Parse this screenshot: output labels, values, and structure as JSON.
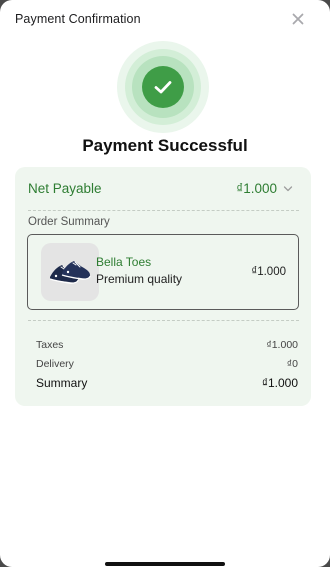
{
  "header": {
    "title": "Payment Confirmation"
  },
  "icons": {
    "close": "close-icon",
    "success": "check-icon",
    "expand": "chevron-down-icon"
  },
  "colors": {
    "accent": "#2e7d32",
    "success": "#3f9d47",
    "card_bg": "#eff6ef"
  },
  "status": {
    "title": "Payment Successful"
  },
  "net_payable": {
    "label": "Net Payable",
    "value": "₫1.000"
  },
  "order": {
    "label": "Order Summary",
    "items": [
      {
        "name": "Bella Toes",
        "description": "Premium quality",
        "price": "₫1.000"
      }
    ]
  },
  "summary": {
    "rows": [
      {
        "label": "Taxes",
        "value": "₫1.000"
      },
      {
        "label": "Delivery",
        "value": "₫0"
      }
    ],
    "total": {
      "label": "Summary",
      "value": "₫1.000"
    }
  }
}
